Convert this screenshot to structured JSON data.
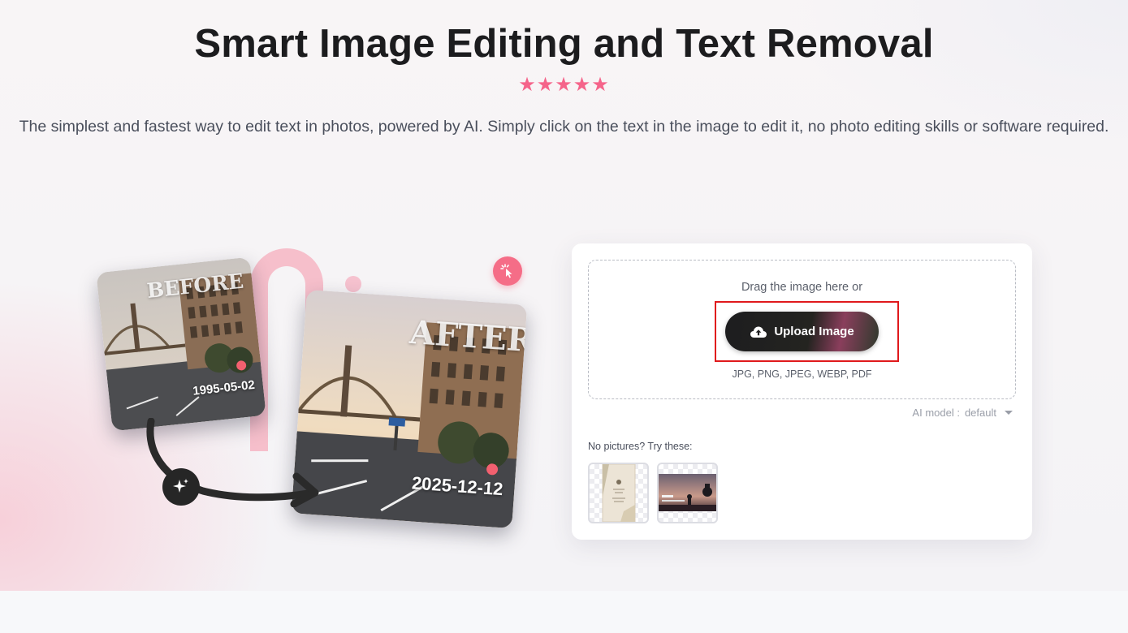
{
  "hero": {
    "title": "Smart Image Editing and Text Removal",
    "stars": "★★★★★",
    "subtitle": "The simplest and fastest way to edit text in photos, powered by AI. Simply click on the text in the image to edit it, no photo editing skills or software required."
  },
  "illustration": {
    "before_label": "BEFORE",
    "before_date": "1995-05-02",
    "after_label": "AFTER",
    "after_date": "2025-12-12"
  },
  "upload": {
    "drag_text": "Drag the image here or",
    "button_label": "Upload Image",
    "formats": "JPG, PNG, JPEG, WEBP, PDF",
    "ai_model_label": "AI model :",
    "ai_model_value": "default",
    "samples_label": "No pictures? Try these:"
  },
  "colors": {
    "accent_pink": "#f5648a",
    "highlight_red": "#e0191c",
    "button_dark": "#1d1d1f"
  },
  "icons": {
    "upload": "cloud-upload-icon",
    "cursor": "cursor-click-icon",
    "sparkle": "sparkle-icon",
    "dropdown": "caret-down-icon"
  }
}
